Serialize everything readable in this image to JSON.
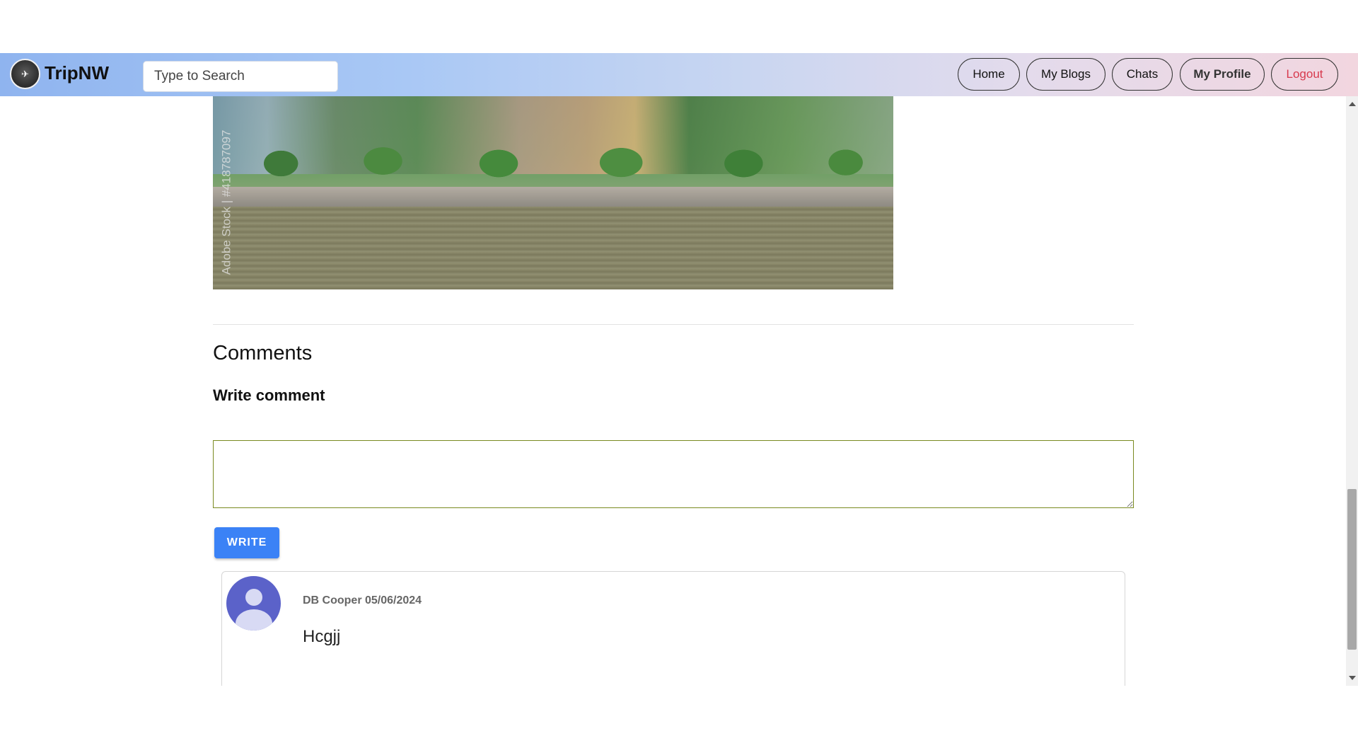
{
  "navbar": {
    "brand": "TripNW",
    "search_placeholder": "Type to Search",
    "buttons": {
      "home": "Home",
      "my_blogs": "My Blogs",
      "chats": "Chats",
      "my_profile": "My Profile",
      "logout": "Logout"
    },
    "colors": {
      "logout": "#d83a4e"
    }
  },
  "post": {
    "image_watermark": "Adobe Stock | #418787097"
  },
  "comments": {
    "title": "Comments",
    "write_label": "Write comment",
    "textarea_value": "",
    "write_button": "WRITE",
    "items": [
      {
        "author_date": "DB Cooper 05/06/2024",
        "text": "Hcgjj"
      }
    ]
  },
  "colors": {
    "accent": "#3b82f6",
    "avatar": "#5b62c9"
  }
}
